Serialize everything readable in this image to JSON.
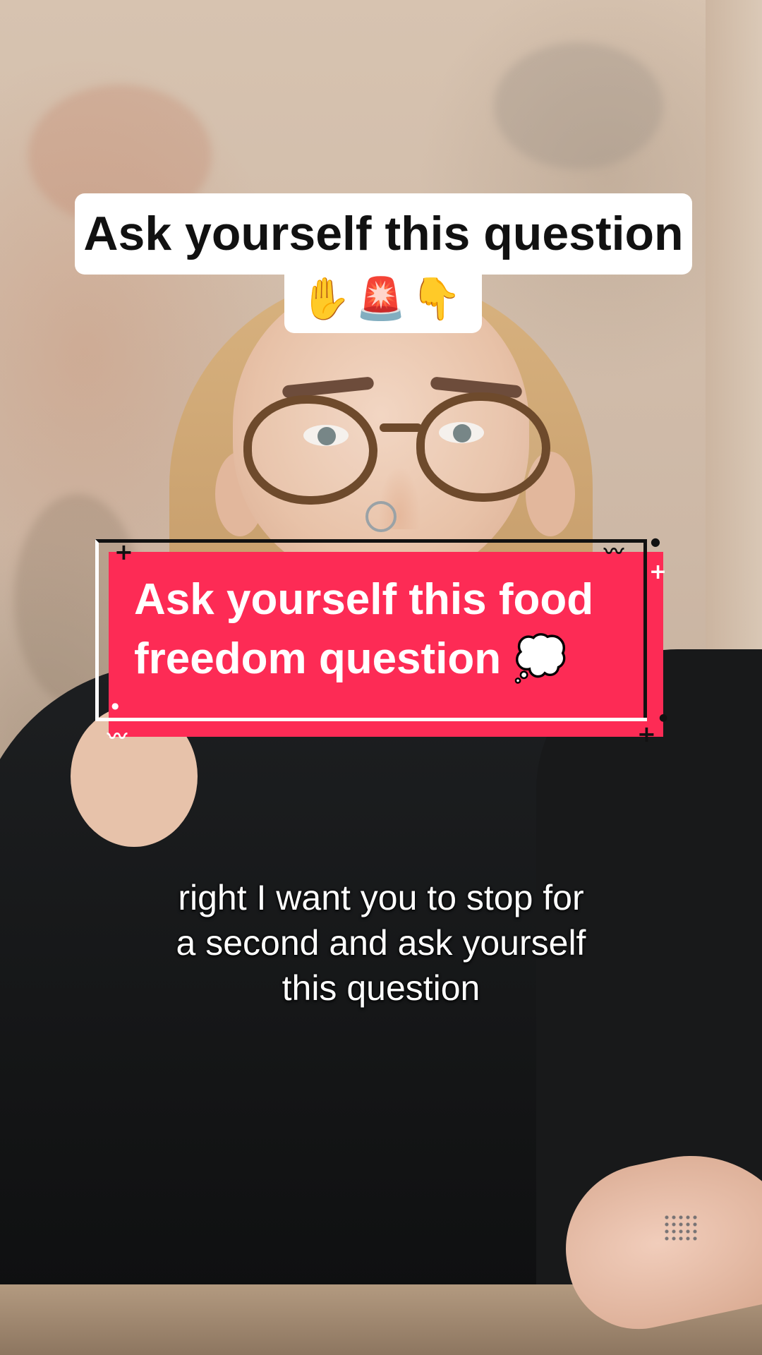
{
  "video": {
    "top_caption": {
      "title": "Ask yourself this question",
      "emojis": "✋🚨👇"
    },
    "sticker": {
      "line1": "Ask yourself this food",
      "line2": "freedom question 💭",
      "background_color": "#fd2b55"
    },
    "subtitle": {
      "line1": "right I want you to stop for",
      "line2": "a second and ask yourself",
      "line3": "this question"
    }
  }
}
